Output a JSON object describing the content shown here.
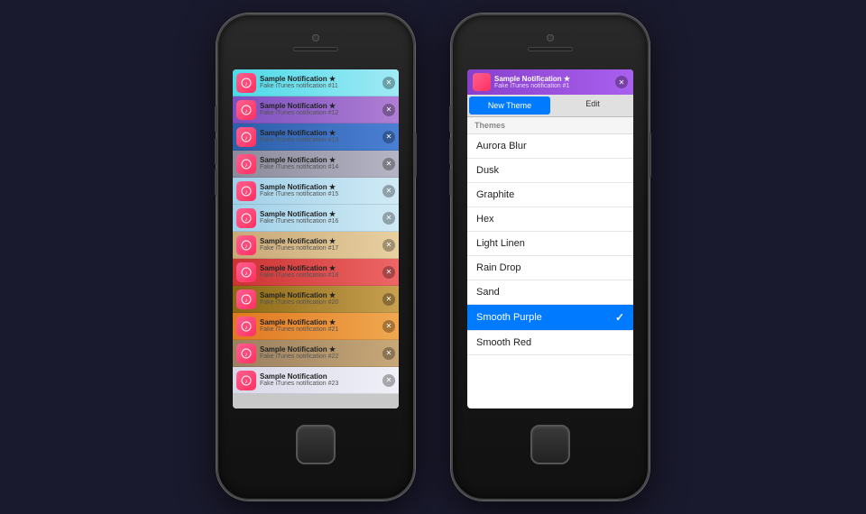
{
  "left_phone": {
    "notifications": [
      {
        "id": 11,
        "title": "Sample Notification ★",
        "subtitle": "Fake iTunes notification #11",
        "theme": "cyan"
      },
      {
        "id": 12,
        "title": "Sample Notification ★",
        "subtitle": "Fake iTunes notification #12",
        "theme": "purple"
      },
      {
        "id": 13,
        "title": "Sample Notification ★",
        "subtitle": "Fake iTunes notification #13",
        "theme": "blue-dark"
      },
      {
        "id": 14,
        "title": "Sample Notification ★",
        "subtitle": "Fake iTunes notification #14",
        "theme": "silver"
      },
      {
        "id": 15,
        "title": "Sample Notification ★",
        "subtitle": "Fake iTunes notification #15",
        "theme": "ice"
      },
      {
        "id": 16,
        "title": "Sample Notification ★",
        "subtitle": "Fake iTunes notification #16",
        "theme": "ice"
      },
      {
        "id": 17,
        "title": "Sample Notification ★",
        "subtitle": "Fake iTunes notification #17",
        "theme": "sand"
      },
      {
        "id": 18,
        "title": "Sample Notification ★",
        "subtitle": "Fake iTunes notification #18",
        "theme": "red"
      },
      {
        "id": 20,
        "title": "Sample Notification ★",
        "subtitle": "Fake iTunes notification #20",
        "theme": "wood"
      },
      {
        "id": 21,
        "title": "Sample Notification ★",
        "subtitle": "Fake iTunes notification #21",
        "theme": "orange"
      },
      {
        "id": 22,
        "title": "Sample Notification ★",
        "subtitle": "Fake iTunes notification #22",
        "theme": "dark-sand"
      },
      {
        "id": 23,
        "title": "Sample Notification",
        "subtitle": "Fake iTunes notification #23",
        "theme": "light"
      }
    ]
  },
  "right_phone": {
    "notification": {
      "title": "Sample Notification ★",
      "subtitle": "Fake iTunes notification #1"
    },
    "tabs": [
      {
        "label": "New Theme",
        "active": true
      },
      {
        "label": "Edit",
        "active": false
      }
    ],
    "themes_header": "Themes",
    "themes": [
      {
        "name": "Aurora Blur",
        "selected": false
      },
      {
        "name": "Dusk",
        "selected": false
      },
      {
        "name": "Graphite",
        "selected": false
      },
      {
        "name": "Hex",
        "selected": false
      },
      {
        "name": "Light Linen",
        "selected": false
      },
      {
        "name": "Rain Drop",
        "selected": false
      },
      {
        "name": "Sand",
        "selected": false
      },
      {
        "name": "Smooth Purple",
        "selected": true
      },
      {
        "name": "Smooth Red",
        "selected": false
      }
    ]
  }
}
